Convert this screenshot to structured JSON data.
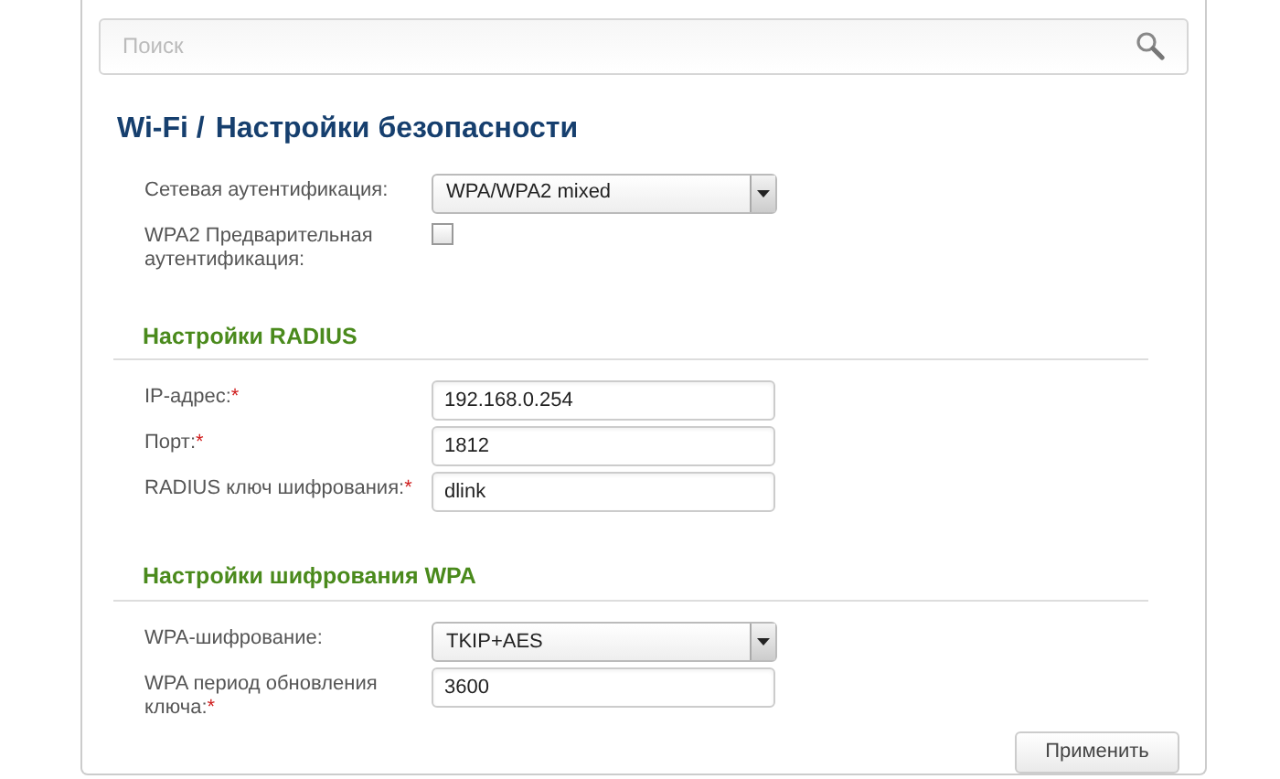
{
  "search": {
    "placeholder": "Поиск"
  },
  "breadcrumb": {
    "parent": "Wi-Fi /",
    "title": "Настройки безопасности"
  },
  "sections": [
    {
      "fields": [
        {
          "kind": "select",
          "label": "Сетевая аутентификация:",
          "value": "WPA/WPA2 mixed"
        },
        {
          "kind": "checkbox",
          "label": "WPA2 Предварительная аутентификация:",
          "checked": false
        }
      ]
    },
    {
      "heading": "Настройки RADIUS",
      "fields": [
        {
          "kind": "text",
          "label": "IP-адрес:",
          "required_mark": "*",
          "value": "192.168.0.254"
        },
        {
          "kind": "text",
          "label": "Порт:",
          "required_mark": "*",
          "value": "1812"
        },
        {
          "kind": "text",
          "label": "RADIUS ключ шифрования:",
          "required_mark": "*",
          "value": "dlink"
        }
      ]
    },
    {
      "heading": "Настройки шифрования WPA",
      "fields": [
        {
          "kind": "select",
          "label": "WPA-шифрование:",
          "value": "TKIP+AES"
        },
        {
          "kind": "text",
          "label": "WPA период обновления ключа:",
          "required_mark": "*",
          "value": "3600"
        }
      ]
    }
  ],
  "apply_button": "Применить"
}
